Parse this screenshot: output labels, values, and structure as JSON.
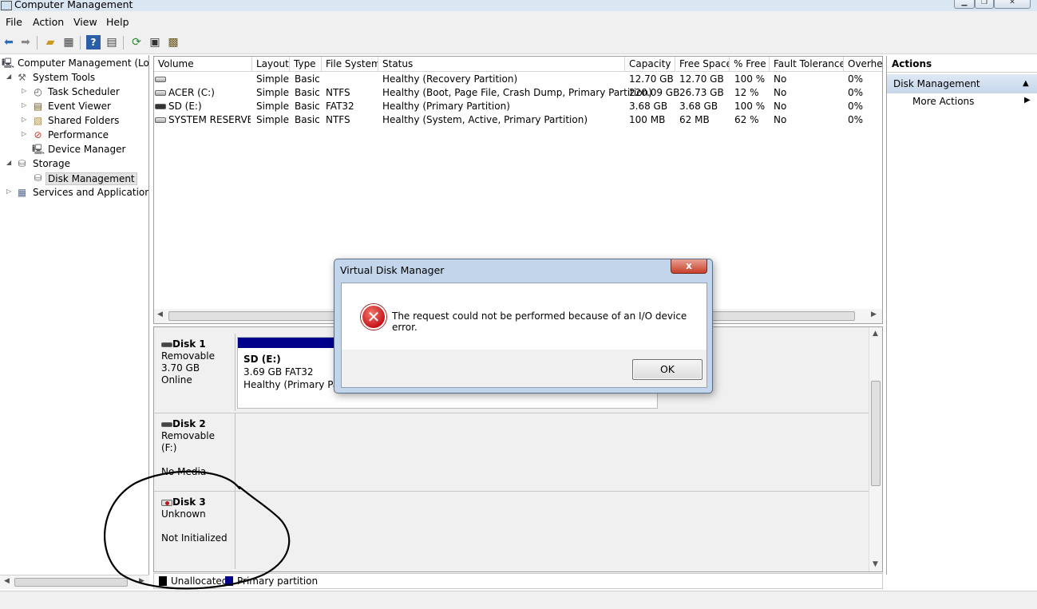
{
  "window": {
    "title": "Computer Management"
  },
  "menu": [
    "File",
    "Action",
    "View",
    "Help"
  ],
  "tree": [
    {
      "label": "Computer Management (Local",
      "icon": "computer-icon",
      "exp": ""
    },
    {
      "label": "System Tools",
      "icon": "tools-icon",
      "exp": "◢"
    },
    {
      "label": "Task Scheduler",
      "icon": "clock-icon",
      "exp": "▷"
    },
    {
      "label": "Event Viewer",
      "icon": "event-viewer-icon",
      "exp": "▷"
    },
    {
      "label": "Shared Folders",
      "icon": "shared-folder-icon",
      "exp": "▷"
    },
    {
      "label": "Performance",
      "icon": "performance-icon",
      "exp": "▷"
    },
    {
      "label": "Device Manager",
      "icon": "device-manager-icon",
      "exp": ""
    },
    {
      "label": "Storage",
      "icon": "storage-icon",
      "exp": "◢"
    },
    {
      "label": "Disk Management",
      "icon": "disk-management-icon",
      "exp": ""
    },
    {
      "label": "Services and Applications",
      "icon": "services-icon",
      "exp": "▷"
    }
  ],
  "volumes": {
    "columns": [
      "Volume",
      "Layout",
      "Type",
      "File System",
      "Status",
      "Capacity",
      "Free Space",
      "% Free",
      "Fault Tolerance",
      "Overhea"
    ],
    "rows": [
      [
        "",
        "Simple",
        "Basic",
        "",
        "Healthy (Recovery Partition)",
        "12.70 GB",
        "12.70 GB",
        "100 %",
        "No",
        "0%"
      ],
      [
        "ACER (C:)",
        "Simple",
        "Basic",
        "NTFS",
        "Healthy (Boot, Page File, Crash Dump, Primary Partition)",
        "220.09 GB",
        "26.73 GB",
        "12 %",
        "No",
        "0%"
      ],
      [
        "SD (E:)",
        "Simple",
        "Basic",
        "FAT32",
        "Healthy (Primary Partition)",
        "3.68 GB",
        "3.68 GB",
        "100 %",
        "No",
        "0%"
      ],
      [
        "SYSTEM RESERVED",
        "Simple",
        "Basic",
        "NTFS",
        "Healthy (System, Active, Primary Partition)",
        "100 MB",
        "62 MB",
        "62 %",
        "No",
        "0%"
      ]
    ]
  },
  "disks": [
    {
      "name": "Disk 1",
      "l1": "Removable",
      "l2": "3.70 GB",
      "l3": "Online"
    },
    {
      "name": "Disk 2",
      "l1": "Removable (F:)",
      "l2": "",
      "l3": "No Media"
    },
    {
      "name": "Disk 3",
      "l1": "Unknown",
      "l2": "",
      "l3": "Not Initialized"
    }
  ],
  "partition": {
    "name": "SD  (E:)",
    "size": "3.69 GB FAT32",
    "status": "Healthy (Primary Part"
  },
  "legend": {
    "unallocated": "Unallocated",
    "primary": "Primary partition"
  },
  "actions": {
    "header": "Actions",
    "section": "Disk Management",
    "item": "More Actions"
  },
  "dialog": {
    "title": "Virtual Disk Manager",
    "close": "x",
    "message": "The request could not be performed because of an I/O device error.",
    "ok": "OK"
  },
  "colors": {
    "primary_partition": "#00008b",
    "unallocated": "#000000",
    "annotation": "#000000"
  }
}
